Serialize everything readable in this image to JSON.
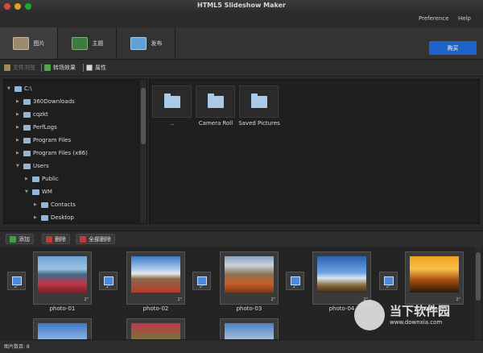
{
  "window": {
    "title": "HTML5 Slideshow Maker"
  },
  "menu": {
    "preference": "Preference",
    "help": "Help"
  },
  "tabs": [
    {
      "label": "图片",
      "icon": "photos-icon",
      "color": "#9a8a70"
    },
    {
      "label": "主题",
      "icon": "theme-icon",
      "color": "#3d7a3d"
    },
    {
      "label": "发布",
      "icon": "publish-icon",
      "color": "#5fa0d8"
    }
  ],
  "buy_label": "购买",
  "toolbar": {
    "file_browser": "文件浏览",
    "transition": "转场效果",
    "properties": "属性"
  },
  "tree": [
    {
      "label": "C:\\",
      "level": 0,
      "expanded": true
    },
    {
      "label": "360Downloads",
      "level": 1,
      "expanded": false
    },
    {
      "label": "cqzkt",
      "level": 1,
      "expanded": false
    },
    {
      "label": "PerfLogs",
      "level": 1,
      "expanded": false
    },
    {
      "label": "Program Files",
      "level": 1,
      "expanded": false
    },
    {
      "label": "Program Files (x86)",
      "level": 1,
      "expanded": false
    },
    {
      "label": "Users",
      "level": 1,
      "expanded": true
    },
    {
      "label": "Public",
      "level": 2,
      "expanded": false
    },
    {
      "label": "WM",
      "level": 2,
      "expanded": true
    },
    {
      "label": "Contacts",
      "level": 3,
      "expanded": false
    },
    {
      "label": "Desktop",
      "level": 3,
      "expanded": false
    }
  ],
  "folders": [
    "..",
    "Camera Roll",
    "Saved Pictures"
  ],
  "actions": {
    "add": "添加",
    "delete": "删除",
    "delete_all": "全部删除"
  },
  "transition_duration": "2\"",
  "slides": [
    {
      "label": "photo-01",
      "duration": "2\""
    },
    {
      "label": "photo-02",
      "duration": "2\""
    },
    {
      "label": "photo-03",
      "duration": "2\""
    },
    {
      "label": "photo-04",
      "duration": "2\""
    },
    {
      "label": "photo-05",
      "duration": "2\""
    }
  ],
  "status": {
    "text": "图片数目: 8"
  },
  "watermark": {
    "brand": "当下软件园",
    "url": "www.downxia.com"
  }
}
